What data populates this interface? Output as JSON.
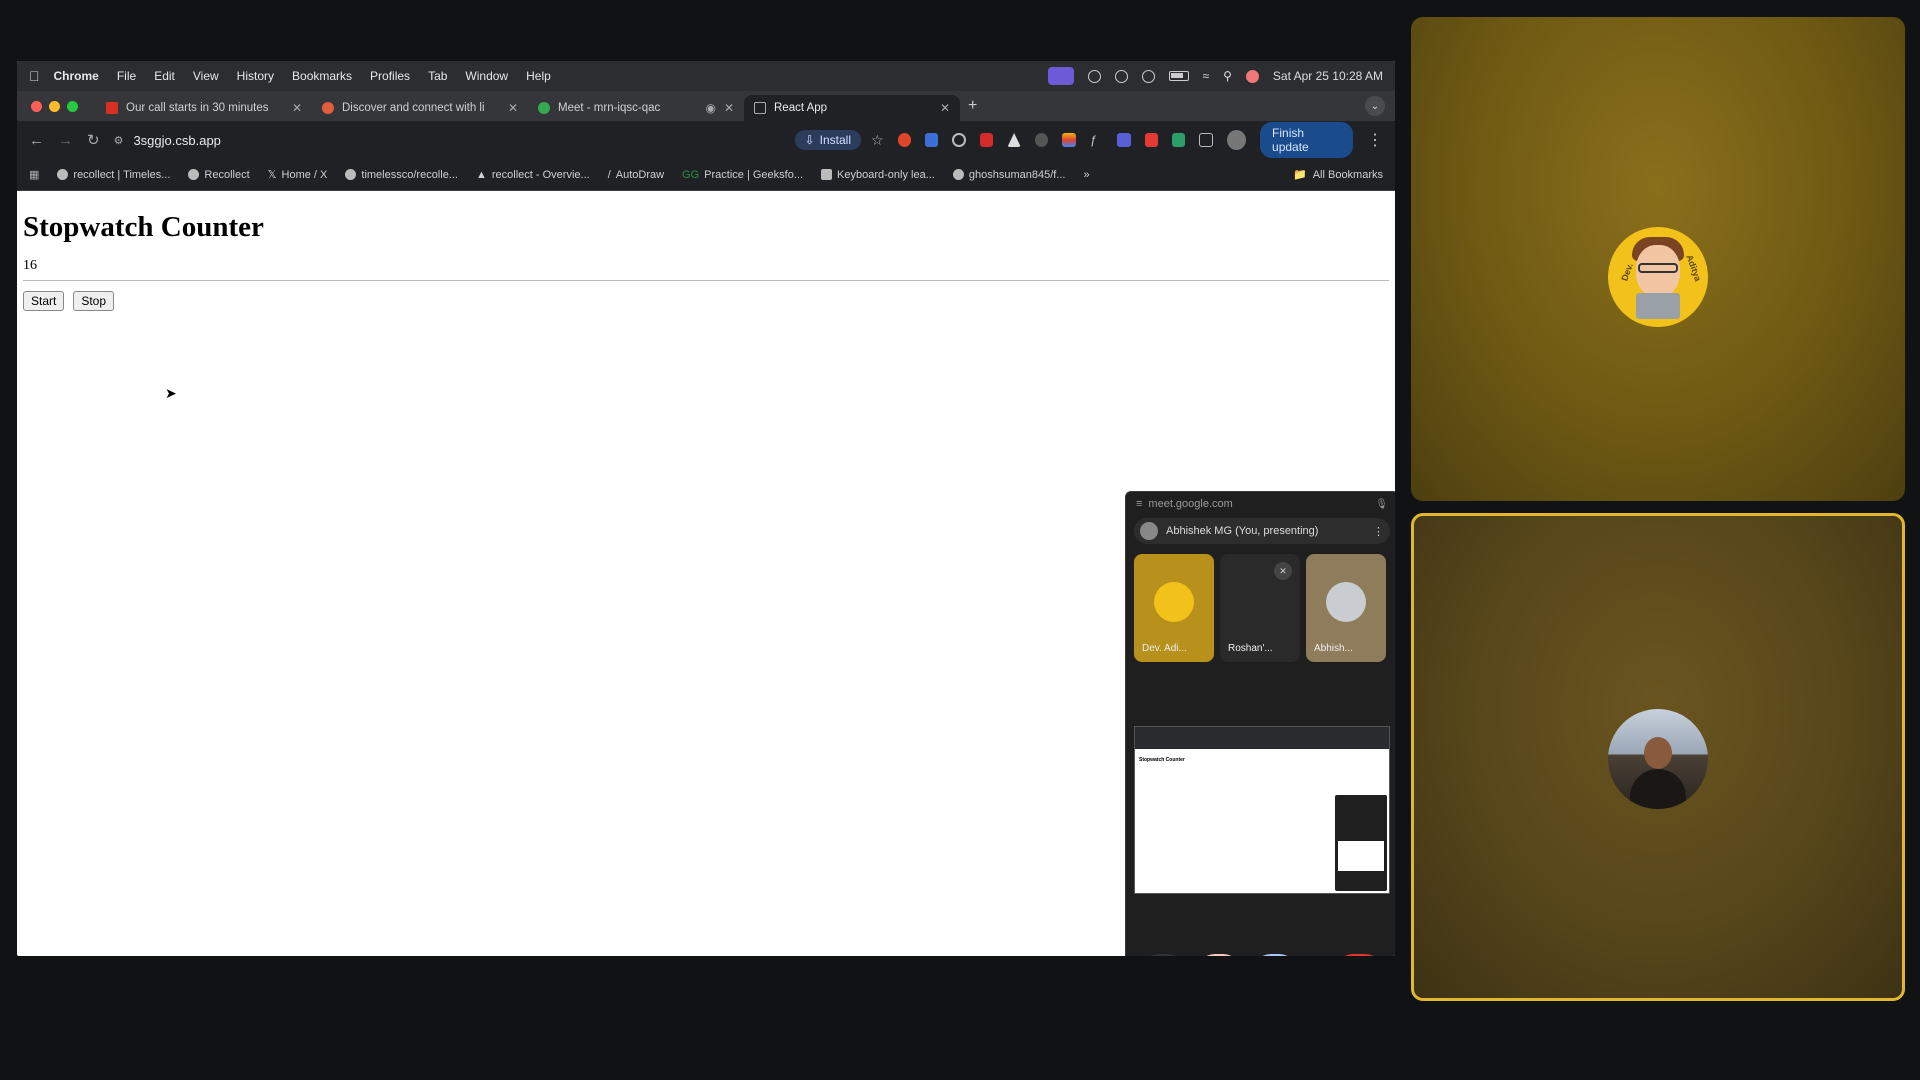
{
  "menubar": {
    "app_name": "Chrome",
    "items": [
      "File",
      "Edit",
      "View",
      "History",
      "Bookmarks",
      "Profiles",
      "Tab",
      "Window",
      "Help"
    ],
    "clock": "Sat Apr 25  10:28 AM"
  },
  "tabs": [
    {
      "title": "Our call starts in 30 minutes",
      "favicon_color": "#d93025",
      "active": false
    },
    {
      "title": "Discover and connect with li",
      "favicon_color": "#e25c3e",
      "active": false
    },
    {
      "title": "Meet - mrn-iqsc-qac",
      "favicon_color": "#34a853",
      "active": false
    },
    {
      "title": "React App",
      "favicon_color": "#888888",
      "active": true
    }
  ],
  "toolbar": {
    "url": "3sggjo.csb.app",
    "install_label": "Install",
    "finish_update_label": "Finish update"
  },
  "bookmarks": {
    "items": [
      "recollect | Timeles...",
      "Recollect",
      "Home / X",
      "timelessco/recolle...",
      "recollect - Overvie...",
      "AutoDraw",
      "Practice | Geeksfo...",
      "Keyboard-only lea...",
      "ghoshsuman845/f..."
    ],
    "all_label": "All Bookmarks"
  },
  "page": {
    "heading": "Stopwatch Counter",
    "count": "16",
    "start_label": "Start",
    "stop_label": "Stop"
  },
  "pip": {
    "domain": "meet.google.com",
    "presenter": "Abhishek MG (You, presenting)",
    "tiles": [
      {
        "name": "Dev. Adi...",
        "color": "#b8901c"
      },
      {
        "name": "Roshan'...",
        "color": "#2a2a2a"
      },
      {
        "name": "Abhish...",
        "color": "#8e7c5a"
      }
    ],
    "preview_title": "Stopwatch Counter"
  },
  "participants": {
    "top_avatar_text_left": "Dev.",
    "top_avatar_text_right": "Aditya"
  },
  "colors": {
    "accent_active_border": "#e3b62f",
    "end_call": "#dc362e",
    "present_button": "#a8c7fa"
  }
}
